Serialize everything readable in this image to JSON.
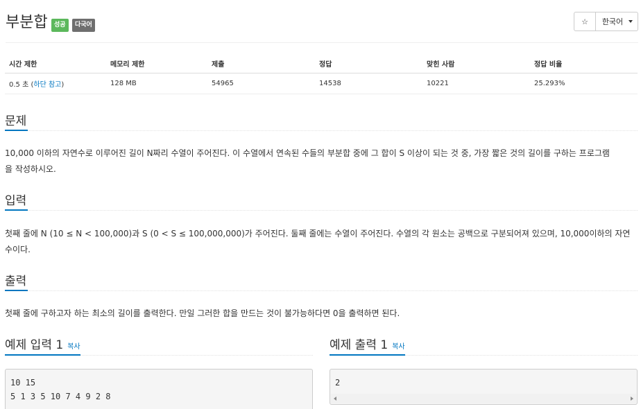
{
  "problem": {
    "title": "부분합",
    "badges": {
      "success": "성공",
      "multilang": "다국어"
    },
    "star_icon": "☆",
    "language": "한국어"
  },
  "info": {
    "headers": [
      "시간 제한",
      "메모리 제한",
      "제출",
      "정답",
      "맞힌 사람",
      "정답 비율"
    ],
    "time_limit": "0.5 초",
    "time_note_open": " (",
    "time_note_link": "하단 참고",
    "time_note_close": ")",
    "memory": "128 MB",
    "submissions": "54965",
    "accepted": "14538",
    "solvers": "10221",
    "ratio": "25.293%"
  },
  "sections": {
    "description": {
      "title": "문제",
      "lines": [
        "10,000 이하의 자연수로 이루어진 길이 N짜리 수열이 주어진다. 이 수열에서 연속된 수들의 부분합 중에 그 합이 S 이상이 되는 것 중, 가장 짧은 것의 길이를 구하는 프로그램",
        "을 작성하시오."
      ]
    },
    "input": {
      "title": "입력",
      "lines": [
        "첫째 줄에 N (10 ≤ N < 100,000)과 S (0 < S ≤ 100,000,000)가 주어진다. 둘째 줄에는 수열이 주어진다. 수열의 각 원소는 공백으로 구분되어져 있으며, 10,000이하의 자연",
        "수이다."
      ]
    },
    "output": {
      "title": "출력",
      "lines": [
        "첫째 줄에 구하고자 하는 최소의 길이를 출력한다. 만일 그러한 합을 만드는 것이 불가능하다면 0을 출력하면 된다."
      ]
    }
  },
  "samples": {
    "input": {
      "title": "예제 입력 1",
      "copy": "복사",
      "lines": [
        "10 15",
        "5 1 3 5 10 7 4 9 2 8"
      ]
    },
    "output": {
      "title": "예제 출력 1",
      "copy": "복사",
      "lines": [
        "2"
      ]
    }
  },
  "colors": {
    "link": "#0076c0",
    "success": "#5cb85c",
    "multilang": "#6f6f6f"
  }
}
